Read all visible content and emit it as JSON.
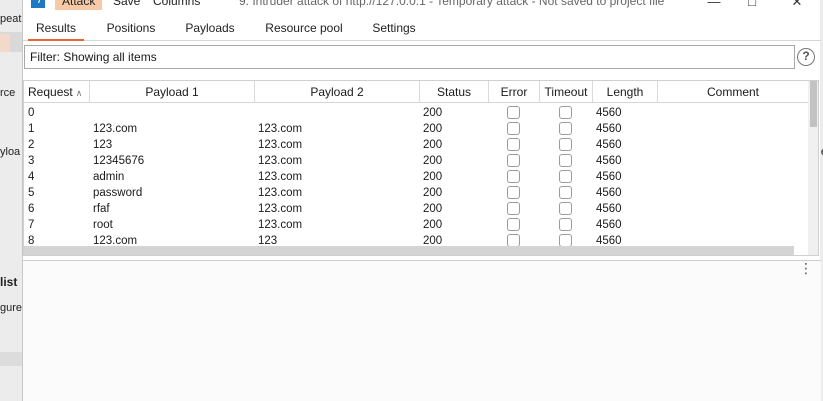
{
  "background_app": {
    "fragments": [
      "peat",
      "rce",
      "yloa",
      "list",
      "gure"
    ],
    "right_fragment": "e"
  },
  "window": {
    "logo_glyph": "ϟ",
    "menus": [
      "Attack",
      "Save",
      "Columns"
    ],
    "title": "9. Intruder attack of http://127.0.0.1 - Temporary attack - Not saved to project file",
    "controls": {
      "minimize": "—",
      "maximize": "□",
      "close": "✕"
    }
  },
  "tabs": [
    "Results",
    "Positions",
    "Payloads",
    "Resource pool",
    "Settings"
  ],
  "filter": {
    "text": "Filter: Showing all items",
    "help_glyph": "?"
  },
  "table": {
    "columns": [
      "Request",
      "Payload 1",
      "Payload 2",
      "Status",
      "Error",
      "Timeout",
      "Length",
      "Comment"
    ],
    "sort_indicator": "∧",
    "rows": [
      {
        "request": "0",
        "payload1": "",
        "payload2": "",
        "status": "200",
        "length": "4560",
        "comment": ""
      },
      {
        "request": "1",
        "payload1": "123.com",
        "payload2": "123.com",
        "status": "200",
        "length": "4560",
        "comment": ""
      },
      {
        "request": "2",
        "payload1": "123",
        "payload2": "123.com",
        "status": "200",
        "length": "4560",
        "comment": ""
      },
      {
        "request": "3",
        "payload1": "12345676",
        "payload2": "123.com",
        "status": "200",
        "length": "4560",
        "comment": ""
      },
      {
        "request": "4",
        "payload1": "admin",
        "payload2": "123.com",
        "status": "200",
        "length": "4560",
        "comment": ""
      },
      {
        "request": "5",
        "payload1": "password",
        "payload2": "123.com",
        "status": "200",
        "length": "4560",
        "comment": ""
      },
      {
        "request": "6",
        "payload1": "rfaf",
        "payload2": "123.com",
        "status": "200",
        "length": "4560",
        "comment": ""
      },
      {
        "request": "7",
        "payload1": "root",
        "payload2": "123.com",
        "status": "200",
        "length": "4560",
        "comment": ""
      },
      {
        "request": "8",
        "payload1": "123.com",
        "payload2": "123",
        "status": "200",
        "length": "4560",
        "comment": ""
      }
    ]
  },
  "lower_pane": {
    "menu_glyph": "⋮"
  },
  "colors": {
    "accent": "#e8653a",
    "active_menu": "#f7c9a7",
    "logo": "#1b79c5"
  }
}
